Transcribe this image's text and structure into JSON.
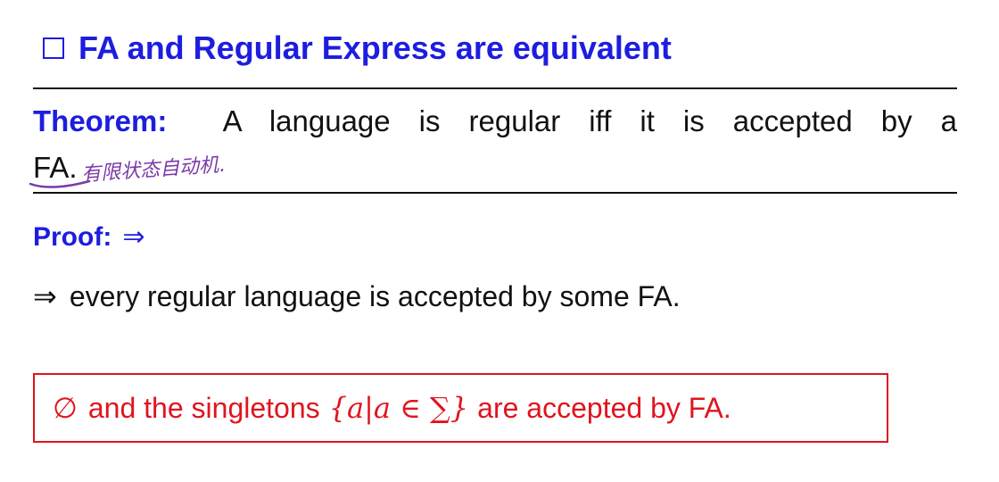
{
  "title": {
    "icon": "square-box-icon",
    "text": "FA and Regular Express are equivalent"
  },
  "theorem": {
    "label": "Theorem:",
    "text": "A language is regular iff it is accepted by a",
    "continuation": "FA.",
    "handwritten_note": "有限状态自动机."
  },
  "proof": {
    "label": "Proof:",
    "arrow": "⇒"
  },
  "claim": {
    "arrow": "⇒",
    "text": "every regular language is accepted by some FA."
  },
  "boxed_statement": {
    "emptyset": "∅",
    "text_before": "and the singletons",
    "math": "{a|a ∈ ∑}",
    "text_after": "are accepted by FA."
  },
  "colors": {
    "heading_blue": "#1d1de0",
    "highlight_red": "#e0141e",
    "annotation_purple": "#7a3aa8",
    "text": "#111111"
  }
}
